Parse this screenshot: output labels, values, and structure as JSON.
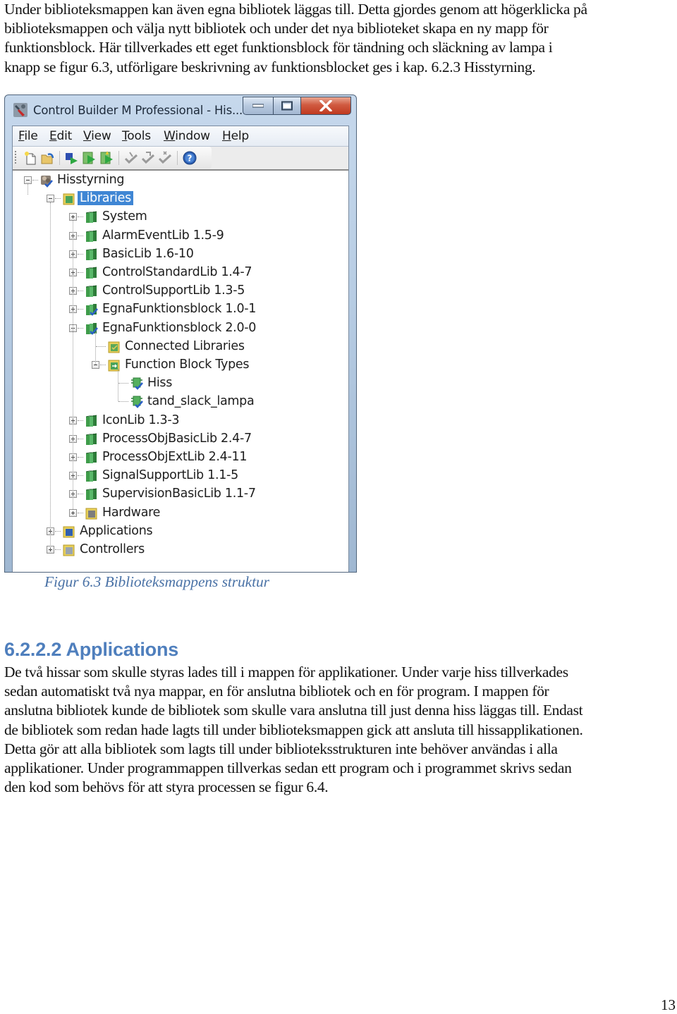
{
  "intro_paragraph": {
    "lines": [
      "Under biblioteksmappen kan även egna bibliotek läggas till. Detta gjordes genom att högerklicka på",
      "biblioteksmappen och välja nytt bibliotek och under det nya biblioteket skapa en ny mapp för",
      "funktionsblock. Här tillverkades ett eget funktionsblock för tändning och släckning av lampa i",
      "knapp se figur 6.3, utförligare beskrivning av funktionsblocket ges i kap. 6.2.3 Hisstyrning."
    ]
  },
  "figure": {
    "window": {
      "title": "Control Builder M Professional - His...",
      "controls": {
        "minimize": "minimize",
        "maximize": "maximize",
        "close": "close"
      },
      "menu": [
        {
          "mnemonic": "F",
          "rest": "ile"
        },
        {
          "mnemonic": "E",
          "rest": "dit"
        },
        {
          "mnemonic": "V",
          "rest": "iew"
        },
        {
          "mnemonic": "T",
          "rest": "ools"
        },
        {
          "mnemonic": "W",
          "rest": "indow"
        },
        {
          "mnemonic": "H",
          "rest": "elp"
        }
      ],
      "toolbar": [
        {
          "icon": "new-document-icon"
        },
        {
          "icon": "open-folder-icon"
        },
        {
          "icon": "download-icon"
        },
        {
          "icon": "go-online-icon"
        },
        {
          "icon": "test-mode-icon"
        },
        {
          "icon": "check-icon"
        },
        {
          "icon": "check-all-icon"
        },
        {
          "icon": "uncheck-icon"
        },
        {
          "icon": "help-icon"
        }
      ],
      "tree": {
        "root": "Hisstyrning",
        "libraries": "Libraries",
        "library_items": [
          "System",
          "AlarmEventLib 1.5-9",
          "BasicLib 1.6-10",
          "ControlStandardLib 1.4-7",
          "ControlSupportLib 1.3-5",
          "EgnaFunktionsblock 1.0-1",
          "EgnaFunktionsblock 2.0-0"
        ],
        "egna_children": {
          "connected_libraries": "Connected Libraries",
          "function_block_types": "Function Block Types",
          "fb_types": [
            "Hiss",
            "tand_slack_lampa"
          ]
        },
        "more_library_items": [
          "IconLib 1.3-3",
          "ProcessObjBasicLib 2.4-7",
          "ProcessObjExtLib 2.4-11",
          "SignalSupportLib 1.1-5",
          "SupervisionBasicLib 1.1-7",
          "Hardware"
        ],
        "top_items": [
          "Applications",
          "Controllers"
        ]
      }
    },
    "caption": "Figur 6.3 Biblioteksmappens struktur"
  },
  "section": {
    "heading": "6.2.2.2 Applications",
    "paragraph_lines": [
      "De två hissar som skulle styras lades till i mappen för applikationer. Under varje hiss tillverkades",
      "sedan automatiskt två nya mappar, en för anslutna bibliotek och en för program. I mappen för",
      "anslutna bibliotek kunde de bibliotek som skulle vara anslutna till just denna hiss läggas till. Endast",
      "de bibliotek som redan hade lagts till under biblioteksmappen gick att ansluta till hissapplikationen.",
      "Detta gör att alla bibliotek som lagts till under biblioteksstrukturen inte behöver användas i alla",
      "applikationer. Under programmappen tillverkas sedan ett program och i programmet skrivs sedan",
      "den kod som behövs för att styra processen se figur 6.4."
    ]
  },
  "page_number": "13",
  "colors": {
    "caption": "#4a72a6",
    "heading": "#4f7fbd",
    "selection": "#3f86d4",
    "close_button": "#c8452b"
  }
}
